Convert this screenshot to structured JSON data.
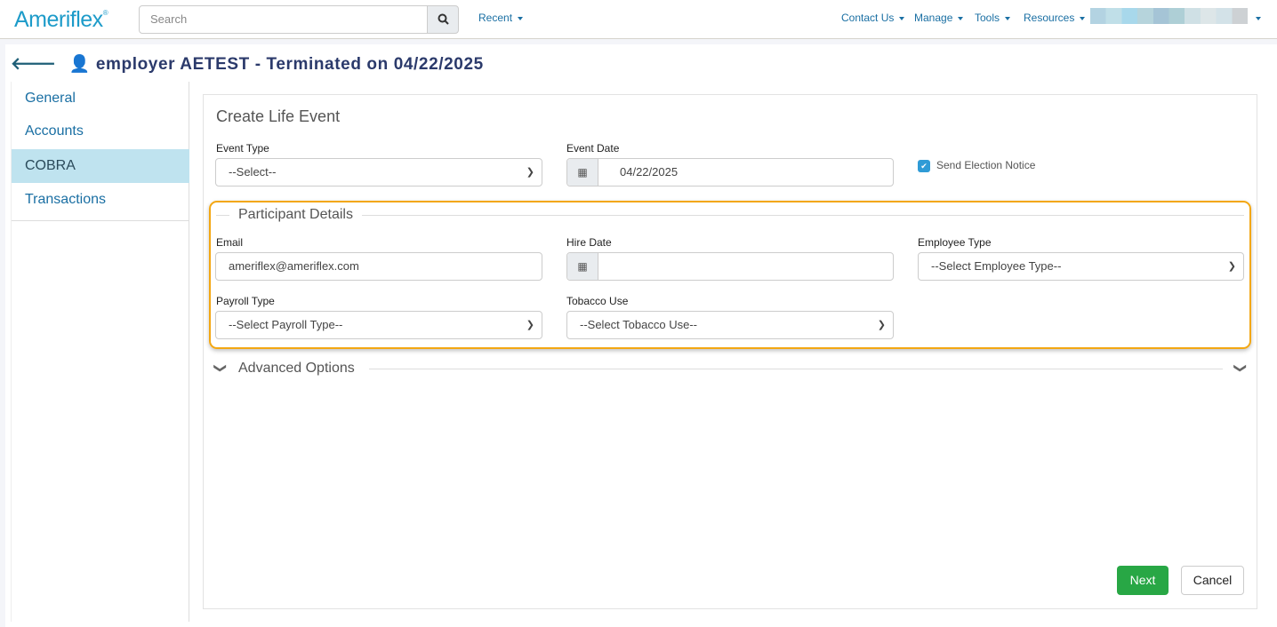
{
  "header": {
    "logo": "Ameriflex",
    "search_placeholder": "Search",
    "recent": "Recent",
    "menu": [
      "Contact Us",
      "Manage",
      "Tools",
      "Resources"
    ]
  },
  "page": {
    "title": "employer AETEST - Terminated on 04/22/2025"
  },
  "sidebar": {
    "items": [
      {
        "label": "General"
      },
      {
        "label": "Accounts"
      },
      {
        "label": "COBRA",
        "active": true
      },
      {
        "label": "Transactions"
      }
    ]
  },
  "form": {
    "heading": "Create Life Event",
    "event_type": {
      "label": "Event Type",
      "value": "--Select--"
    },
    "event_date": {
      "label": "Event Date",
      "value": "04/22/2025"
    },
    "send_notice": {
      "label": "Send Election Notice",
      "checked": true
    },
    "participant": {
      "legend": "Participant Details",
      "email": {
        "label": "Email",
        "value": "ameriflex@ameriflex.com"
      },
      "hire_date": {
        "label": "Hire Date",
        "value": ""
      },
      "employee_type": {
        "label": "Employee Type",
        "value": "--Select Employee Type--"
      },
      "payroll_type": {
        "label": "Payroll Type",
        "value": "--Select Payroll Type--"
      },
      "tobacco_use": {
        "label": "Tobacco Use",
        "value": "--Select Tobacco Use--"
      }
    },
    "advanced": "Advanced Options",
    "next": "Next",
    "cancel": "Cancel"
  },
  "colors": {
    "accent": "#1a6fa3",
    "highlight": "#f3a712",
    "success": "#28a745"
  }
}
